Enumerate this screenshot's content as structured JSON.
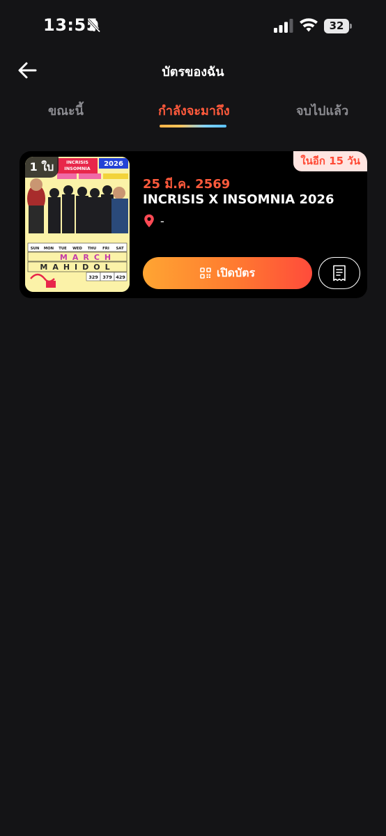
{
  "status_bar": {
    "time": "13:55",
    "battery": "32",
    "icons": [
      "bell-slash-icon",
      "cellular-signal-icon",
      "wifi-icon",
      "battery-icon"
    ]
  },
  "header": {
    "title": "บัตรของฉัน",
    "back_icon": "arrow-left-icon"
  },
  "tabs": [
    {
      "label": "ขณะนี้",
      "active": false
    },
    {
      "label": "กำลังจะมาถึง",
      "active": true
    },
    {
      "label": "จบไปแล้ว",
      "active": false
    }
  ],
  "colors": {
    "background": "#141416",
    "card": "#000000",
    "accent": "#ff5a3c",
    "badge_bg": "#ffe5e1",
    "button_gradient": [
      "#ffa532",
      "#ff4b3b"
    ]
  },
  "ticket": {
    "quantity": "1 ใบ",
    "countdown": "ในอีก 15 วัน",
    "date": "25 มี.ค. 2569",
    "name": "INCRISIS X INSOMNIA 2026",
    "location": "-",
    "location_icon": "map-pin-icon",
    "open_button_label": "เปิดบัตร",
    "open_button_icon": "qr-code-icon",
    "receipt_icon": "receipt-icon",
    "poster": {
      "title_lines": [
        "INCRISIS",
        "INSOMNIA"
      ],
      "year": "2026",
      "weekdays": [
        "SUN",
        "MON",
        "TUE",
        "WED",
        "THU",
        "FRI",
        "SAT"
      ],
      "month": "MARCH",
      "venue": "MAHIDOL",
      "prices": [
        "329",
        "379",
        "429"
      ]
    }
  }
}
